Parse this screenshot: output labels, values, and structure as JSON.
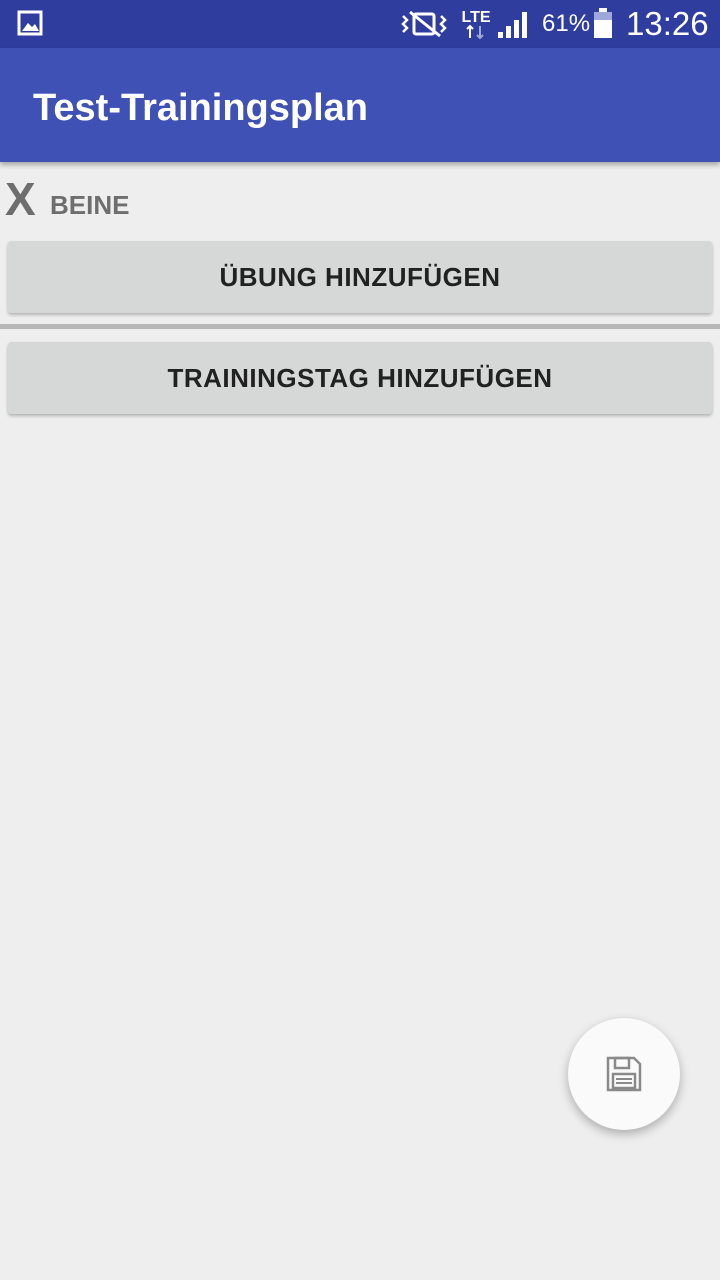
{
  "status_bar": {
    "battery_percent": "61%",
    "time": "13:26",
    "network": "LTE",
    "icons": [
      "gallery-icon",
      "vibrate-icon",
      "lte-icon",
      "signal-icon",
      "battery-icon"
    ]
  },
  "app_bar": {
    "title": "Test-Trainingsplan"
  },
  "training_day": {
    "remove_label": "X",
    "name": "BEINE",
    "add_exercise_label": "ÜBUNG HINZUFÜGEN"
  },
  "add_day_label": "TRAININGSTAG HINZUFÜGEN",
  "fab": {
    "icon": "save-icon"
  },
  "colors": {
    "status_bar": "#2f3d9e",
    "app_bar": "#3f51b5",
    "background": "#eeeeee",
    "button": "#d6d7d7"
  }
}
